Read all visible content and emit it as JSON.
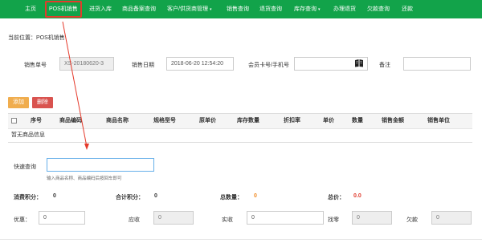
{
  "nav": {
    "items": [
      {
        "label": "主页"
      },
      {
        "label": "POS机销售"
      },
      {
        "label": "进货入库"
      },
      {
        "label": "商品备案查询"
      },
      {
        "label": "客户/供货商管理"
      },
      {
        "label": "销售查询"
      },
      {
        "label": "退货查询"
      },
      {
        "label": "库存查询"
      },
      {
        "label": "办理退货"
      },
      {
        "label": "欠款查询"
      },
      {
        "label": "还款"
      }
    ],
    "active_index": 1,
    "dropdown_caret": "▾"
  },
  "breadcrumb": "当前位置：POS机销售",
  "form": {
    "sale_no_label": "销售单号",
    "sale_no_value": "XS-20180620-3",
    "sale_date_label": "销售日期",
    "sale_date_value": "2018-06-20 12:54:20",
    "member_label": "会员卡号/手机号",
    "member_value": "",
    "remark_label": "备注",
    "remark_value": ""
  },
  "buttons": {
    "add": "添加",
    "delete": "删除"
  },
  "table": {
    "columns": [
      "序号",
      "商品编码",
      "商品名称",
      "规格型号",
      "原单价",
      "库存数量",
      "折扣率",
      "单价",
      "数量",
      "销售金额",
      "销售单位"
    ],
    "empty_text": "暂无商品信息"
  },
  "quick_search": {
    "label": "快速查询",
    "value": "",
    "hint": "输入商品名称、商品编码后按回车即可"
  },
  "summary": {
    "points_label": "消费积分：",
    "points_value": "0",
    "total_points_label": "合计积分：",
    "total_points_value": "0",
    "total_qty_label": "总数量：",
    "total_qty_value": "0",
    "total_price_label": "总价：",
    "total_price_value": "0.0"
  },
  "payment": {
    "discount_label": "优惠：",
    "discount_value": "0",
    "receivable_label": "应收",
    "receivable_value": "0",
    "received_label": "实收",
    "received_value": "0",
    "change_label": "找零",
    "change_value": "0",
    "debt_label": "欠款",
    "debt_value": "0"
  },
  "colors": {
    "nav_bg": "#12a34a",
    "highlight": "#e53b2c",
    "add_button": "#f0ad4e",
    "delete_button": "#d9534f",
    "focus_border": "#66afe9"
  }
}
